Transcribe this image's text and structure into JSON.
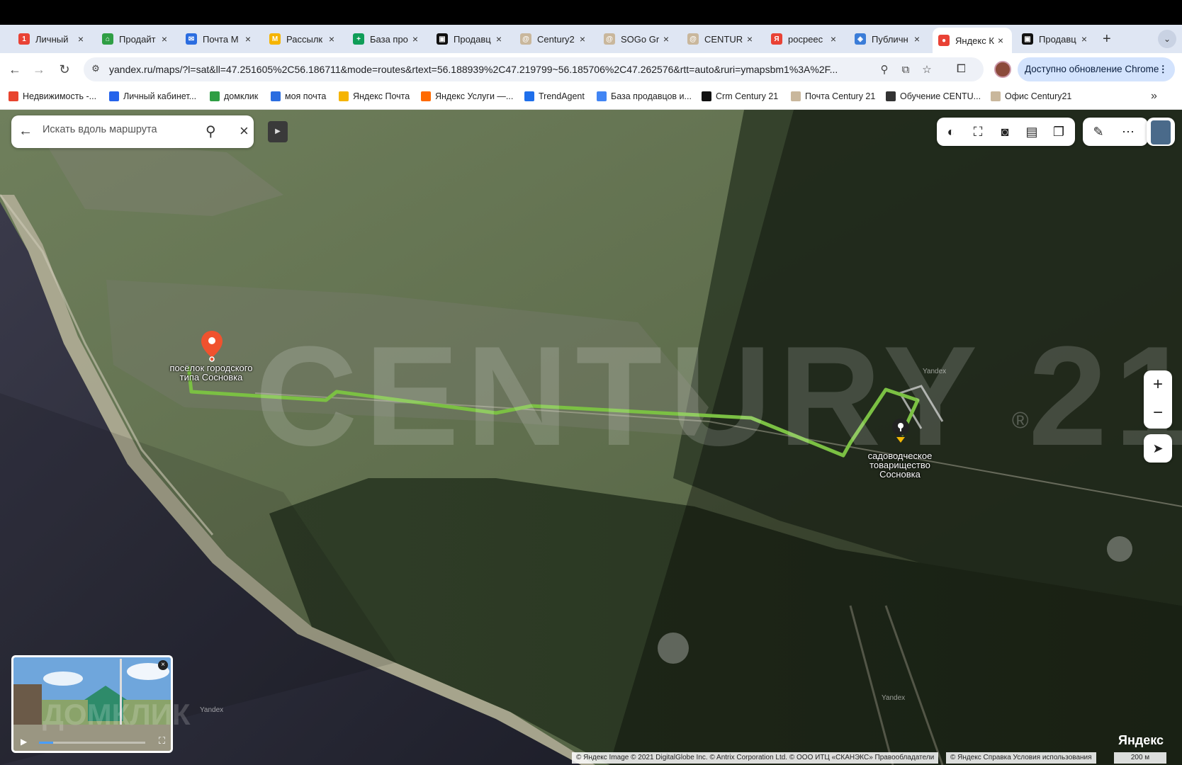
{
  "browser": {
    "tabs": [
      {
        "title": "Личный",
        "color": "#e94235",
        "glyph": "1"
      },
      {
        "title": "Продайт",
        "color": "#2f9e44",
        "glyph": "⌂"
      },
      {
        "title": "Почта M",
        "color": "#2b6de0",
        "glyph": "✉"
      },
      {
        "title": "Рассылк",
        "color": "#f5b400",
        "glyph": "M"
      },
      {
        "title": "База про",
        "color": "#0f9d58",
        "glyph": "+"
      },
      {
        "title": "Продавц",
        "color": "#111111",
        "glyph": "▣"
      },
      {
        "title": "Century2",
        "color": "#c9b79c",
        "glyph": "@"
      },
      {
        "title": "SOGo Gr",
        "color": "#c9b79c",
        "glyph": "@"
      },
      {
        "title": "CENTUR",
        "color": "#c9b79c",
        "glyph": "@"
      },
      {
        "title": "росреес",
        "color": "#e94235",
        "glyph": "Я"
      },
      {
        "title": "Публичн",
        "color": "#3b7dd8",
        "glyph": "◈"
      },
      {
        "title": "Яндекс К",
        "color": "#e94235",
        "glyph": "●",
        "active": true
      },
      {
        "title": "Продавц",
        "color": "#111111",
        "glyph": "▣"
      }
    ],
    "new_tab": "+",
    "url": "yandex.ru/maps/?l=sat&ll=47.251605%2C56.186711&mode=routes&rtext=56.188939%2C47.219799~56.185706%2C47.262576&rtt=auto&ruri=ymapsbm1%3A%2F...",
    "update_label": "Доступно обновление Chrome",
    "bookmarks": [
      {
        "label": "Недвижимость -...",
        "color": "#e8442e"
      },
      {
        "label": "Личный кабинет...",
        "color": "#2563eb"
      },
      {
        "label": "домклик",
        "color": "#2f9e44"
      },
      {
        "label": "моя почта",
        "color": "#2b6de0"
      },
      {
        "label": "Яндекс Почта",
        "color": "#f5b400"
      },
      {
        "label": "Яндекс Услуги —...",
        "color": "#ff6a00"
      },
      {
        "label": "TrendAgent",
        "color": "#1f6feb"
      },
      {
        "label": "База продавцов и...",
        "color": "#4285f4"
      },
      {
        "label": "Crm Century 21",
        "color": "#111111"
      },
      {
        "label": "Почта Century 21",
        "color": "#c9b79c"
      },
      {
        "label": "Обучение CENTU...",
        "color": "#333333"
      },
      {
        "label": "Офис Century21",
        "color": "#c9b79c"
      }
    ]
  },
  "map": {
    "search_placeholder": "Искать вдоль маршрута",
    "watermark": "CENTURY 21",
    "watermark_mark": "®",
    "start_label": "посёлок городского типа Сосновка",
    "end_label": "садоводческое товарищество Сосновка",
    "domclick_watermark": "ДОМКЛИК",
    "yandex_logo": "Яндекс",
    "yandex_small": "Yandex",
    "copyright": "© Яндекс Image © 2021 DigitalGlobe Inc. © Antrix Corporation Ltd. © ООО ИТЦ «СКАНЭКС»  Правообладатели",
    "copyright_links": "© Яндекс  Справка  Условия использования",
    "scale": "200 м",
    "zoom_in": "+",
    "zoom_out": "−",
    "route_color": "#7bc043"
  }
}
